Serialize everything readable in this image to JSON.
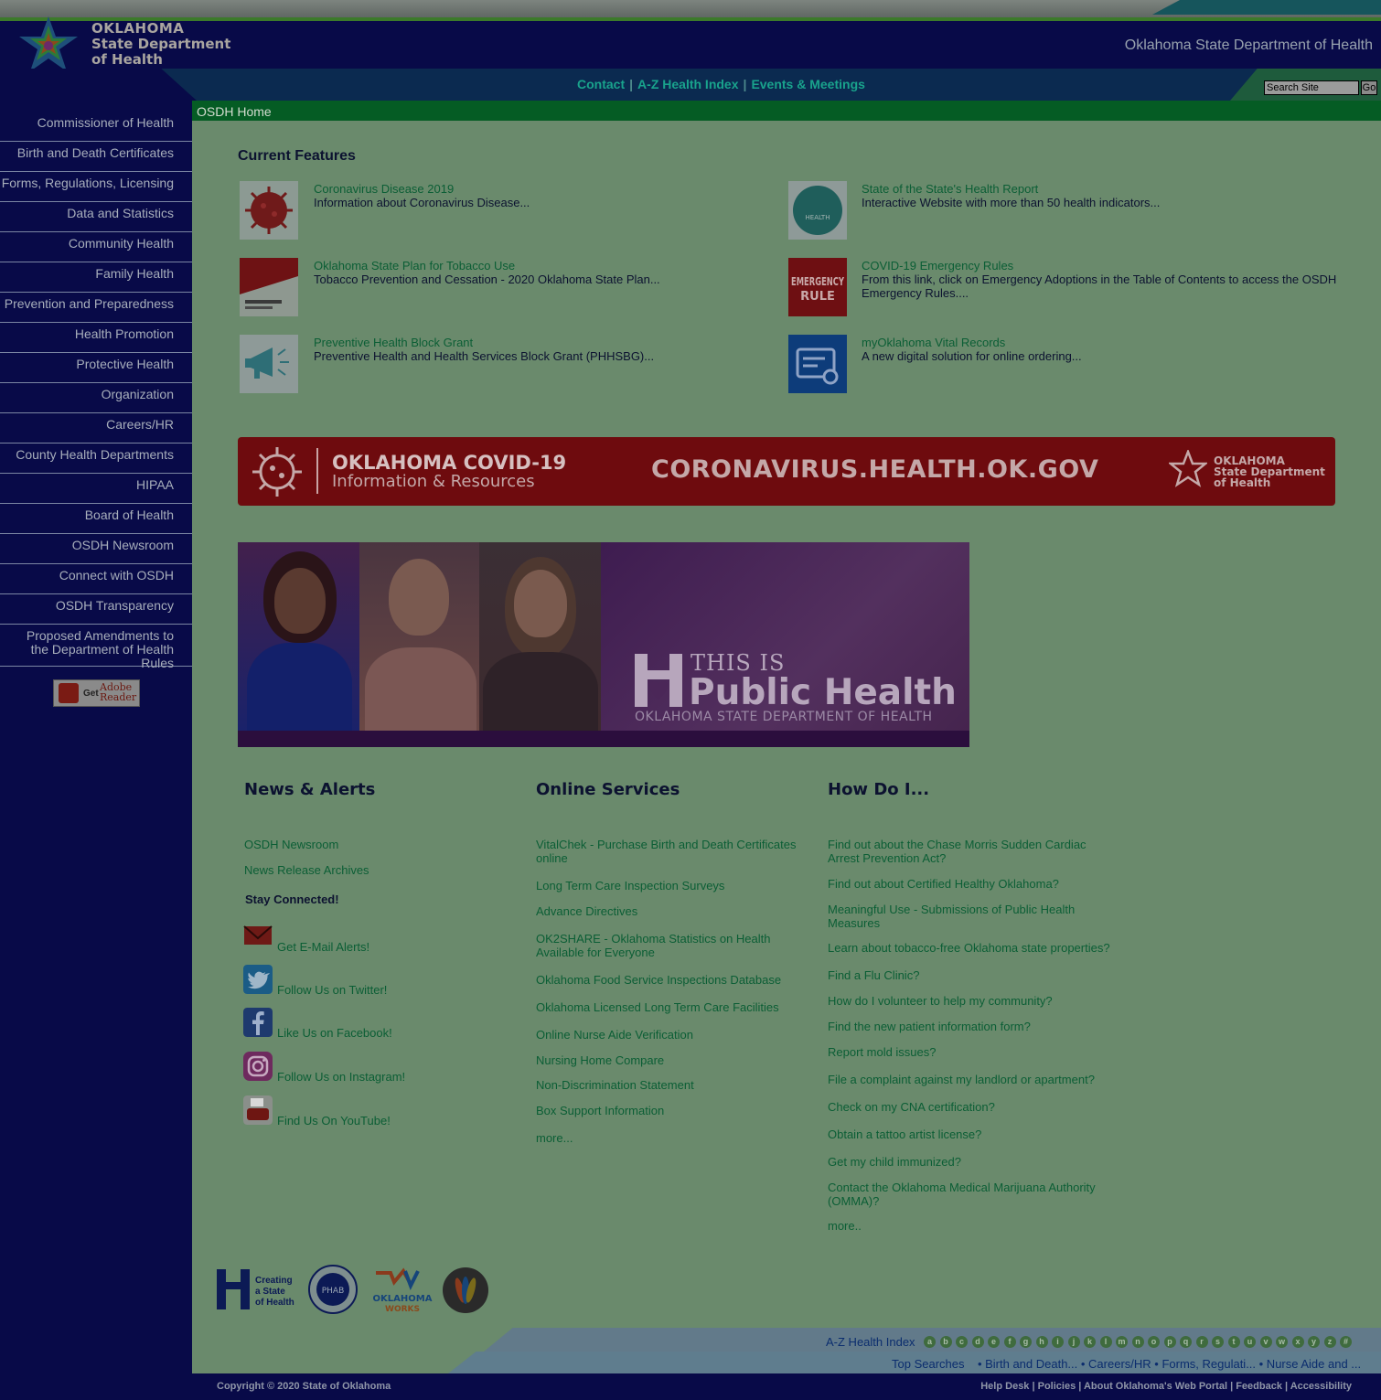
{
  "site": {
    "logo": {
      "line1": "OKLAHOMA",
      "line2": "State Department",
      "line3": "of Health"
    },
    "header_title": "Oklahoma State Department of Health"
  },
  "top_nav": {
    "links": [
      "Contact",
      "A-Z Health Index",
      "Events & Meetings"
    ],
    "separator": "|",
    "search_placeholder": "Search Site",
    "go_label": "Go"
  },
  "breadcrumb": "OSDH Home",
  "sidebar": {
    "items": [
      "Commissioner of Health",
      "Birth and Death Certificates",
      "Forms, Regulations, Licensing",
      "Data and Statistics",
      "Community Health",
      "Family Health",
      "Prevention and Preparedness",
      "Health Promotion",
      "Protective Health",
      "Organization",
      "Careers/HR",
      "County Health Departments",
      "HIPAA",
      "Board of Health",
      "OSDH Newsroom",
      "Connect with OSDH",
      "OSDH Transparency",
      "Proposed Amendments to the Department of Health Rules"
    ],
    "adobe": {
      "get": "Get",
      "adobe": "Adobe",
      "reader": "Reader"
    }
  },
  "features": {
    "heading": "Current Features",
    "items": [
      {
        "title": "Coronavirus Disease 2019",
        "desc": "Information about Coronavirus Disease..."
      },
      {
        "title": "State of the State's Health Report",
        "desc": "Interactive Website with more than 50 health indicators..."
      },
      {
        "title": "Oklahoma State Plan for Tobacco Use",
        "desc": "Tobacco Prevention and Cessation - 2020 Oklahoma State Plan..."
      },
      {
        "title": "COVID-19 Emergency Rules",
        "desc": "From this link, click on Emergency Adoptions in the Table of Contents to access the OSDH Emergency Rules...."
      },
      {
        "title": "Preventive Health Block Grant",
        "desc": "Preventive Health and Health Services Block Grant (PHHSBG)..."
      },
      {
        "title": "myOklahoma Vital Records",
        "desc": "A new digital solution for online ordering..."
      }
    ],
    "thumb_labels": {
      "emergency_1": "EMERGENCY",
      "emergency_2": "RULE",
      "health_seal": "HEALTH"
    }
  },
  "covid_banner": {
    "line1": "OKLAHOMA COVID-19",
    "line2": "Information & Resources",
    "url": "CORONAVIRUS.HEALTH.OK.GOV",
    "logo1": "OKLAHOMA",
    "logo2": "State Department",
    "logo3": "of Health"
  },
  "public_health_banner": {
    "line1": "THIS IS",
    "line2": "Public Health",
    "line3": "OKLAHOMA STATE DEPARTMENT OF HEALTH"
  },
  "news": {
    "heading": "News & Alerts",
    "links": [
      "OSDH Newsroom",
      "News Release Archives"
    ],
    "stay_connected": "Stay Connected!",
    "social": [
      {
        "label": "Get E-Mail Alerts!",
        "icon": "email-icon"
      },
      {
        "label": "Follow Us on Twitter!",
        "icon": "twitter-icon"
      },
      {
        "label": "Like Us on Facebook!",
        "icon": "facebook-icon"
      },
      {
        "label": "Follow Us on Instagram!",
        "icon": "instagram-icon"
      },
      {
        "label": "Find Us On YouTube!",
        "icon": "youtube-icon"
      }
    ]
  },
  "online_services": {
    "heading": "Online Services",
    "links": [
      "VitalChek - Purchase Birth and Death Certificates online",
      "Long Term Care Inspection Surveys",
      "Advance Directives",
      "OK2SHARE - Oklahoma Statistics on Health Available for Everyone",
      "Oklahoma Food Service Inspections Database",
      "Oklahoma Licensed Long Term Care Facilities",
      "Online Nurse Aide Verification",
      "Nursing Home Compare",
      "Non-Discrimination Statement",
      "Box Support Information",
      "more..."
    ]
  },
  "how_do_i": {
    "heading": "How Do I...",
    "links": [
      "Find out about the Chase Morris Sudden Cardiac Arrest Prevention Act?",
      "Find out about Certified Healthy Oklahoma?",
      "Meaningful Use - Submissions of Public Health Measures",
      "Learn about tobacco-free Oklahoma state properties?",
      "Find a Flu Clinic?",
      "How do I volunteer to help my community?",
      "Find the new patient information form?",
      "Report mold issues?",
      "File a complaint against my landlord or apartment?",
      "Check on my CNA certification?",
      "Obtain a tattoo artist license?",
      "Get my child immunized?",
      "Contact the Oklahoma Medical Marijuana Authority (OMMA)?",
      "more.."
    ]
  },
  "footer_logos": {
    "creating": [
      "Creating",
      "a State",
      "of Health"
    ],
    "phab": "PHAB",
    "ok_works_1": "OKLAHOMA",
    "ok_works_2": "WORKS"
  },
  "az_index": {
    "label": "A-Z Health Index",
    "letters": [
      "a",
      "b",
      "c",
      "d",
      "e",
      "f",
      "g",
      "h",
      "i",
      "j",
      "k",
      "l",
      "m",
      "n",
      "o",
      "p",
      "q",
      "r",
      "s",
      "t",
      "u",
      "v",
      "w",
      "x",
      "y",
      "z",
      "#"
    ]
  },
  "top_searches": "Top Searches    • Birth and Death... • Careers/HR • Forms, Regulati... • Nurse Aide and ...",
  "footer": {
    "copyright": "Copyright © 2020 State of Oklahoma",
    "links": "Help Desk | Policies | About Oklahoma's Web Portal | Feedback | Accessibility"
  }
}
